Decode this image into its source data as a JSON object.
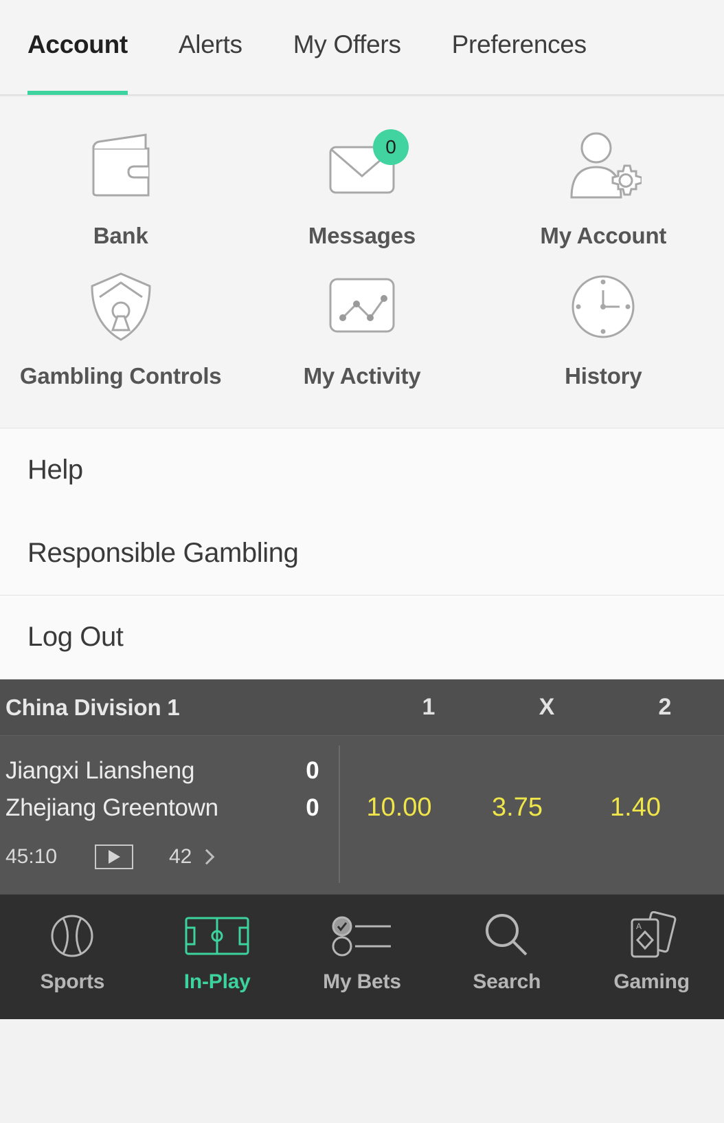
{
  "theme": {
    "accent_green": "#3dd39e",
    "badge_green": "#41d3a0",
    "odds_yellow": "#f0e64a",
    "panel_dark": "#555555",
    "nav_dark": "#2f2f2f"
  },
  "tabs": [
    {
      "label": "Account",
      "active": true
    },
    {
      "label": "Alerts",
      "active": false
    },
    {
      "label": "My Offers",
      "active": false
    },
    {
      "label": "Preferences",
      "active": false
    }
  ],
  "grid": {
    "row1": [
      {
        "label": "Bank",
        "icon": "wallet-icon"
      },
      {
        "label": "Messages",
        "icon": "envelope-icon",
        "badge": "0"
      },
      {
        "label": "My Account",
        "icon": "user-gear-icon"
      }
    ],
    "row2": [
      {
        "label": "Gambling Controls",
        "icon": "shield-keyhole-icon"
      },
      {
        "label": "My Activity",
        "icon": "line-chart-icon"
      },
      {
        "label": "History",
        "icon": "clock-icon"
      }
    ]
  },
  "links": {
    "group1": [
      {
        "label": "Help"
      },
      {
        "label": "Responsible Gambling"
      }
    ],
    "group2": [
      {
        "label": "Log Out"
      }
    ]
  },
  "match_panel": {
    "competition": "China Division 1",
    "columns": [
      "1",
      "X",
      "2"
    ],
    "teams": [
      {
        "name": "Jiangxi Liansheng",
        "score": "0"
      },
      {
        "name": "Zhejiang Greentown",
        "score": "0"
      }
    ],
    "clock": "45:10",
    "stream_icon": "play-icon",
    "markets_count": "42",
    "chevron_icon": "chevron-right-icon",
    "odds": [
      "10.00",
      "3.75",
      "1.40"
    ]
  },
  "bottom_nav": [
    {
      "label": "Sports",
      "icon": "ball-icon",
      "active": false
    },
    {
      "label": "In-Play",
      "icon": "pitch-icon",
      "active": true
    },
    {
      "label": "My Bets",
      "icon": "bet-list-icon",
      "active": false
    },
    {
      "label": "Search",
      "icon": "search-icon",
      "active": false
    },
    {
      "label": "Gaming",
      "icon": "cards-icon",
      "active": false
    }
  ]
}
